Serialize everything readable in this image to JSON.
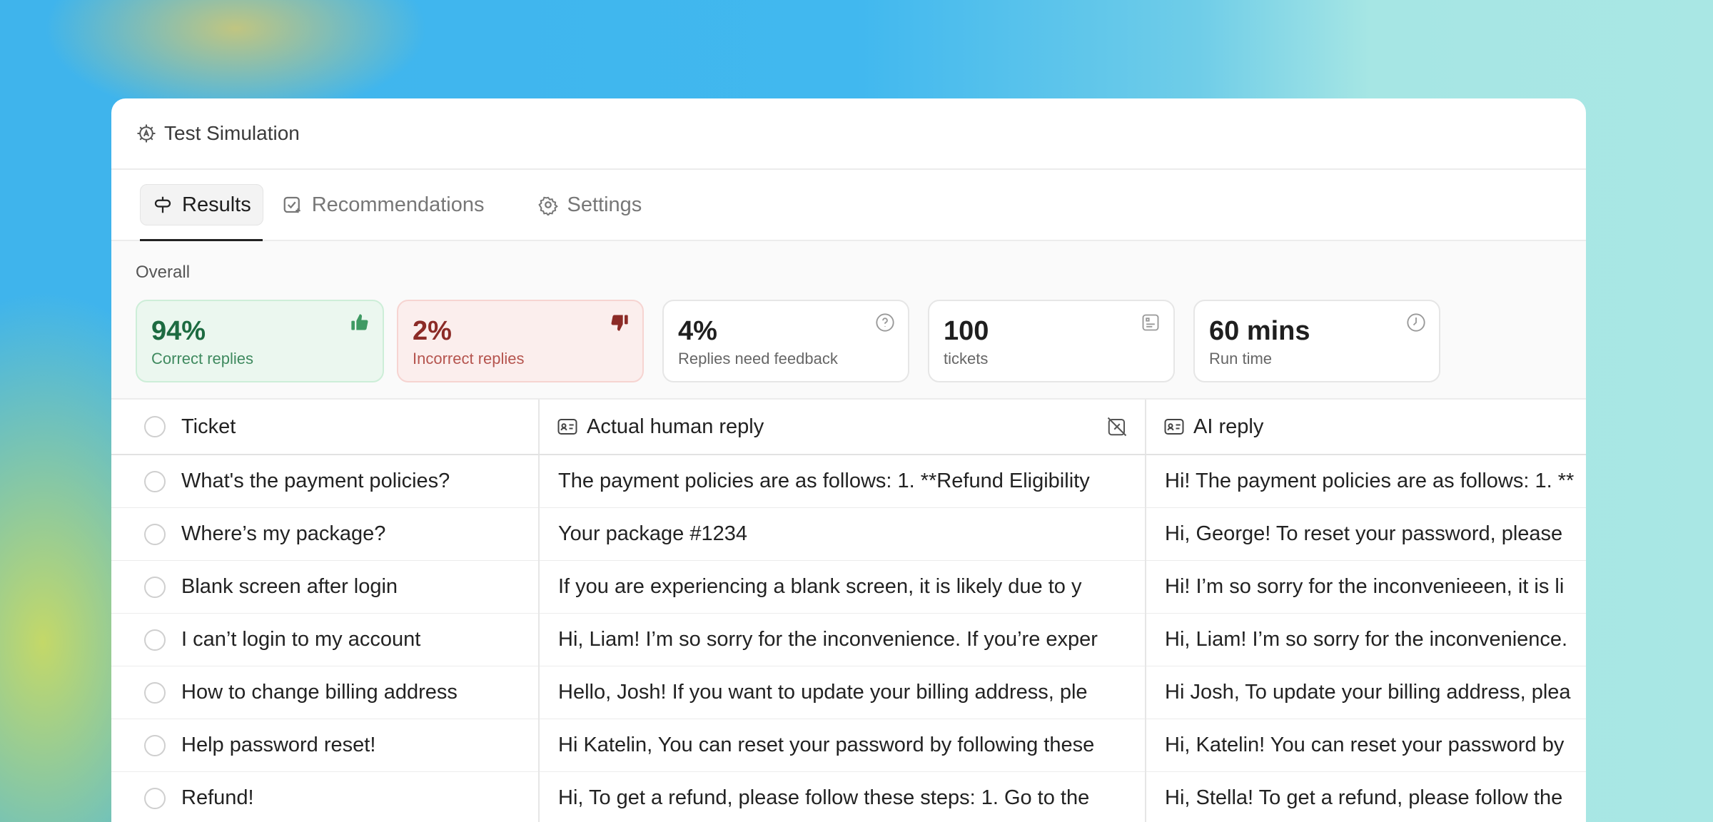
{
  "window": {
    "title": "Test Simulation",
    "title_icon": "ai-chip-icon"
  },
  "tabs": [
    {
      "label": "Results",
      "icon": "signpost-icon",
      "active": true
    },
    {
      "label": "Recommendations",
      "icon": "checklist-icon",
      "active": false
    },
    {
      "label": "Settings",
      "icon": "gear-icon",
      "active": false
    }
  ],
  "overall": {
    "label": "Overall",
    "stats": [
      {
        "value": "94%",
        "label": "Correct replies",
        "icon": "thumbs-up-icon",
        "color": "#1d6b41"
      },
      {
        "value": "2%",
        "label": "Incorrect replies",
        "icon": "thumbs-down-icon",
        "color": "#8c2b27"
      },
      {
        "value": "4%",
        "label": "Replies need feedback",
        "icon": "question-icon"
      },
      {
        "value": "100",
        "label": "tickets",
        "icon": "ticket-icon"
      },
      {
        "value": "60 mins",
        "label": "Run time",
        "icon": "clock-icon"
      }
    ]
  },
  "table": {
    "headers": {
      "ticket": "Ticket",
      "human": "Actual human reply",
      "ai": "AI reply"
    },
    "rows": [
      {
        "ticket": "What's the payment policies?",
        "human": "The payment policies are as follows: 1. **Refund Eligibility",
        "ai": "Hi! The payment policies are as follows: 1. **"
      },
      {
        "ticket": "Where’s my package?",
        "human": "Your package #1234",
        "ai": "Hi, George! To reset your password, please"
      },
      {
        "ticket": "Blank screen after login",
        "human": "If you are experiencing a blank screen, it is likely due to y",
        "ai": "Hi! I’m so sorry for the inconvenieeen, it is li"
      },
      {
        "ticket": "I can’t login to my account",
        "human": "Hi, Liam! I’m so sorry for the inconvenience. If you’re exper",
        "ai": "Hi, Liam! I’m so sorry for the inconvenience."
      },
      {
        "ticket": "How to change billing address",
        "human": "Hello, Josh! If you want to update your billing address, ple",
        "ai": "Hi Josh, To update your billing address, plea"
      },
      {
        "ticket": "Help password reset!",
        "human": "Hi Katelin, You can reset your password by following these",
        "ai": "Hi, Katelin! You can reset your password by"
      },
      {
        "ticket": "Refund!",
        "human": "Hi, To get a refund, please follow these steps: 1. Go to the",
        "ai": "Hi, Stella! To get a refund, please follow the"
      }
    ]
  }
}
